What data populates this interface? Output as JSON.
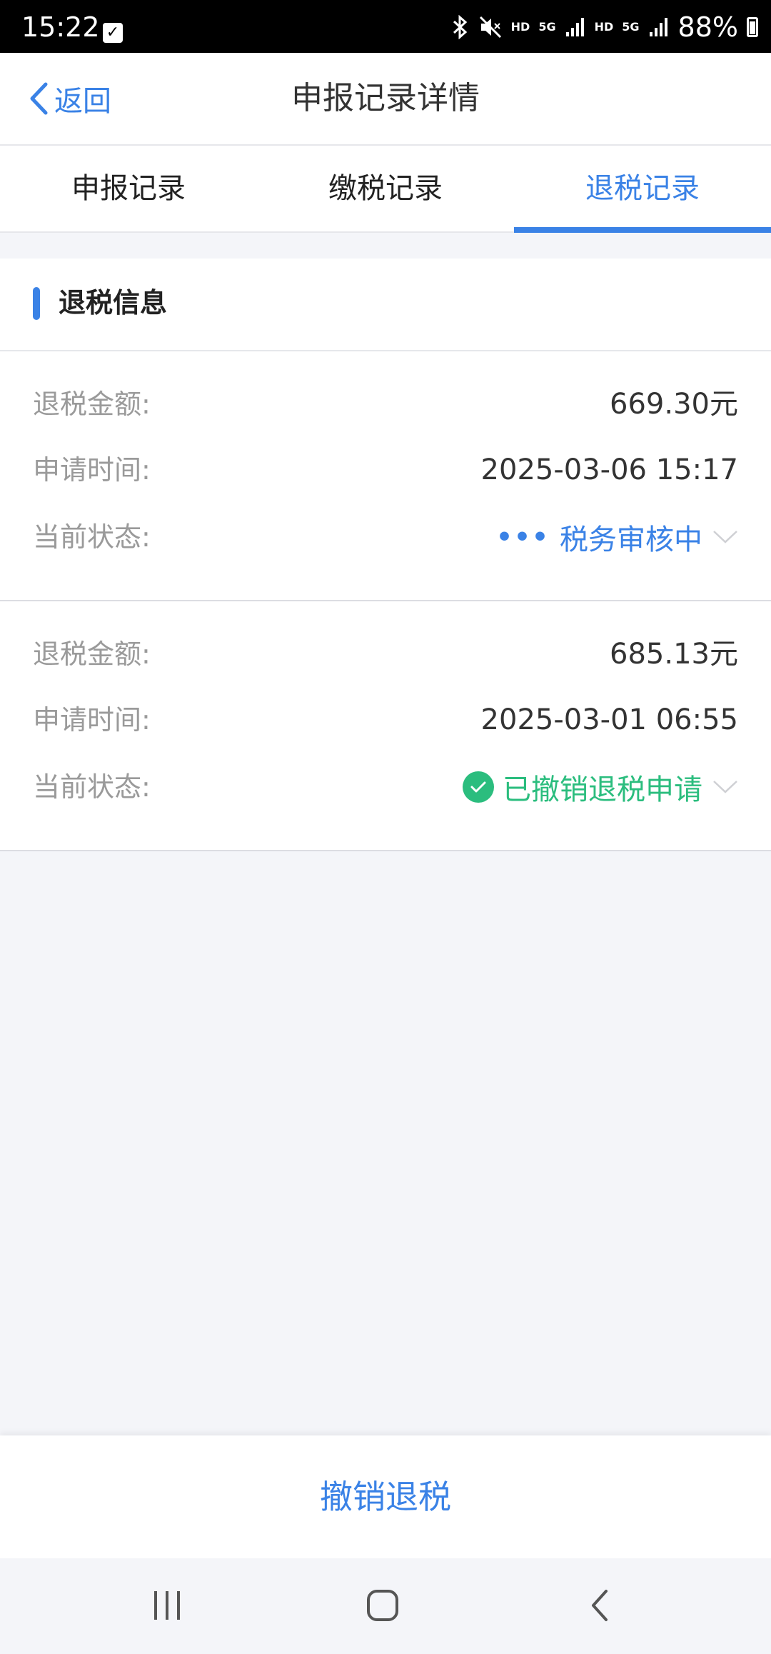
{
  "status_bar": {
    "time": "15:22",
    "notification_icon": "check-box-icon",
    "network_a": "HD",
    "network_b": "5G",
    "network_c": "HD",
    "network_d": "5G",
    "battery": "88%"
  },
  "header": {
    "back_label": "返回",
    "title": "申报记录详情"
  },
  "tabs": [
    {
      "label": "申报记录",
      "active": false
    },
    {
      "label": "缴税记录",
      "active": false
    },
    {
      "label": "退税记录",
      "active": true
    }
  ],
  "section": {
    "title": "退税信息"
  },
  "labels": {
    "amount": "退税金额:",
    "time": "申请时间:",
    "status": "当前状态:"
  },
  "records": [
    {
      "amount": "669.30元",
      "time": "2025-03-06 15:17",
      "status": "税务审核中",
      "status_icon": "dots-icon",
      "status_color": "#3a82e6"
    },
    {
      "amount": "685.13元",
      "time": "2025-03-01 06:55",
      "status": "已撤销退税申请",
      "status_icon": "check-circle-icon",
      "status_color": "#2bbd7e"
    }
  ],
  "bottom": {
    "action_label": "撤销退税"
  },
  "colors": {
    "accent": "#3a82e6",
    "success": "#2bbd7e"
  }
}
